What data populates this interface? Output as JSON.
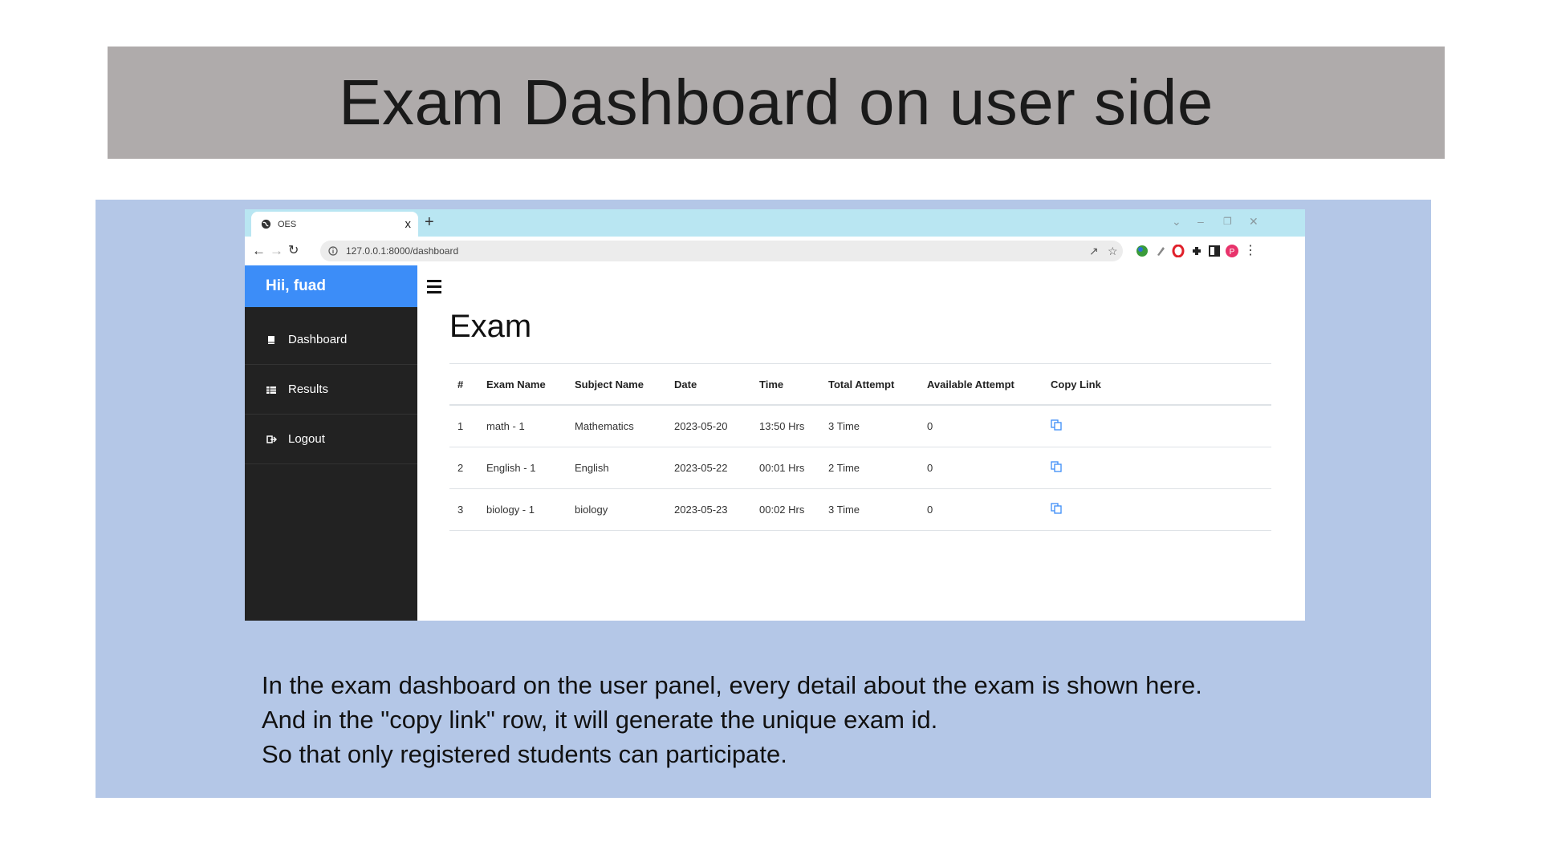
{
  "slide_title": "Exam Dashboard on user side",
  "browser": {
    "tab_title": "OES",
    "tab_close": "x",
    "new_tab": "+",
    "url": "127.0.0.1:8000/dashboard"
  },
  "sidebar": {
    "greeting": "Hii, fuad",
    "items": [
      {
        "label": "Dashboard",
        "icon": "book-icon"
      },
      {
        "label": "Results",
        "icon": "table-icon"
      },
      {
        "label": "Logout",
        "icon": "sign-out-icon"
      }
    ]
  },
  "main": {
    "title": "Exam",
    "table": {
      "headers": [
        "#",
        "Exam Name",
        "Subject Name",
        "Date",
        "Time",
        "Total Attempt",
        "Available Attempt",
        "Copy Link"
      ],
      "rows": [
        [
          "1",
          "math - 1",
          "Mathematics",
          "2023-05-20",
          "13:50 Hrs",
          "3 Time",
          "0"
        ],
        [
          "2",
          "English - 1",
          "English",
          "2023-05-22",
          "00:01 Hrs",
          "2 Time",
          "0"
        ],
        [
          "3",
          "biology - 1",
          "biology",
          "2023-05-23",
          "00:02 Hrs",
          "3 Time",
          "0"
        ]
      ]
    }
  },
  "description": [
    "In the exam dashboard on the user panel, every detail about the exam is shown here.",
    "And in the \"copy link\" row, it will generate the unique exam id.",
    "So that only registered students can participate."
  ],
  "colors": {
    "sidebar_bg": "#222222",
    "sidebar_header": "#3c8df8",
    "tabbar": "#b9e6f2",
    "panel": "#b4c7e7",
    "title_band": "#afabab",
    "copy_icon": "#3c8df8"
  }
}
